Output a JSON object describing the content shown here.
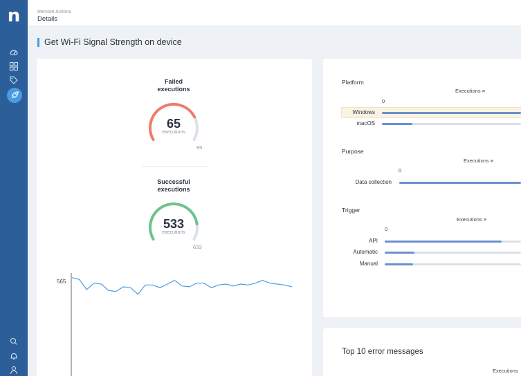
{
  "sidebar": {
    "logo": "n",
    "icons": [
      "dashboard-icon",
      "grid-icon",
      "tag-icon",
      "rocket-icon",
      "search-icon",
      "bell-icon",
      "user-icon"
    ]
  },
  "header": {
    "section": "Remote Actions",
    "page": "Details"
  },
  "title": "Get Wi-Fi Signal Strength on device",
  "gauges": {
    "failed": {
      "title_line1": "Failed",
      "title_line2": "executions",
      "value": "65",
      "unit": "executions",
      "max": "85",
      "fraction": 0.76,
      "color": "#ee7c69"
    },
    "success": {
      "title_line1": "Successful",
      "title_line2": "executions",
      "value": "533",
      "unit": "executions",
      "max": "633",
      "fraction": 0.84,
      "color": "#6dc38b"
    }
  },
  "trend": {
    "y_label": "565",
    "values": [
      565,
      563,
      552,
      559,
      558,
      551,
      550,
      555,
      554,
      547,
      557,
      557,
      554,
      558,
      562,
      556,
      555,
      559,
      559,
      554,
      557,
      558,
      556,
      558,
      557,
      559,
      562,
      559,
      558,
      557,
      555
    ],
    "ymin": 540,
    "ymax": 570,
    "color": "#4a9be6"
  },
  "platform": {
    "title": "Platform",
    "column": "Executions",
    "tick": "0",
    "rows": [
      {
        "label": "Windows",
        "fraction": 1.0,
        "highlight": true
      },
      {
        "label": "macOS",
        "fraction": 0.22,
        "highlight": false
      }
    ]
  },
  "purpose": {
    "title": "Purpose",
    "column": "Executions",
    "tick": "0",
    "rows": [
      {
        "label": "Data collection",
        "fraction": 1.0
      }
    ]
  },
  "trigger": {
    "title": "Trigger",
    "column": "Executions",
    "tick": "0",
    "rows": [
      {
        "label": "API",
        "fraction": 0.86
      },
      {
        "label": "Automatic",
        "fraction": 0.22
      },
      {
        "label": "Manual",
        "fraction": 0.21
      }
    ]
  },
  "errors": {
    "title": "Top 10 error messages",
    "column": "Executions"
  }
}
